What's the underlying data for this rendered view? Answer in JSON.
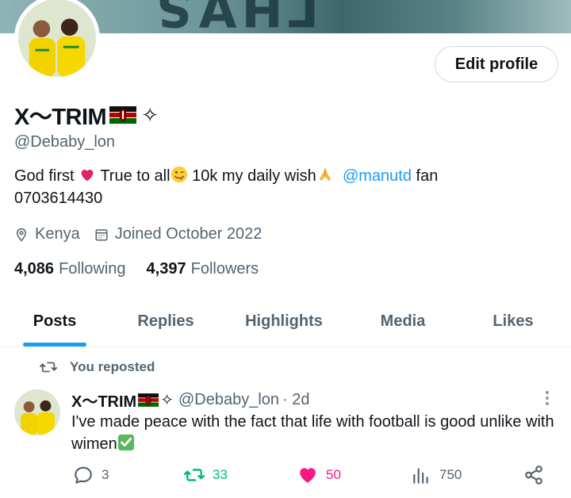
{
  "profile": {
    "name": "X〜TRIM",
    "name_suffix": "✧",
    "handle": "@Debaby_lon",
    "bio_parts": {
      "p1": "God first ",
      "p2": " True to all",
      "p3": " 10k my daily wish",
      "mention": "@manutd",
      "p4": " fan",
      "phone": "0703614430"
    },
    "location": "Kenya",
    "joined": "Joined October 2022",
    "following_count": "4,086",
    "following_label": "Following",
    "followers_count": "4,397",
    "followers_label": "Followers",
    "edit_button": "Edit profile"
  },
  "tabs": [
    "Posts",
    "Replies",
    "Highlights",
    "Media",
    "Likes"
  ],
  "active_tab": "Posts",
  "post": {
    "repost_label": "You reposted",
    "author_name": "X〜TRIM",
    "author_suffix": "✧",
    "author_handle": "@Debaby_lon",
    "time": "· 2d",
    "text": "I've made peace with the fact that life with football is good unlike with wimen",
    "replies": "3",
    "reposts": "33",
    "likes": "50",
    "views": "750"
  },
  "colors": {
    "accent": "#1d9bf0",
    "repost_green": "#00ba7c",
    "like_pink": "#f91880",
    "muted_text": "#536471"
  },
  "icons": [
    "location-icon",
    "calendar-icon",
    "repost-icon",
    "reply-icon",
    "heart-icon",
    "views-icon",
    "share-icon",
    "more-icon"
  ]
}
